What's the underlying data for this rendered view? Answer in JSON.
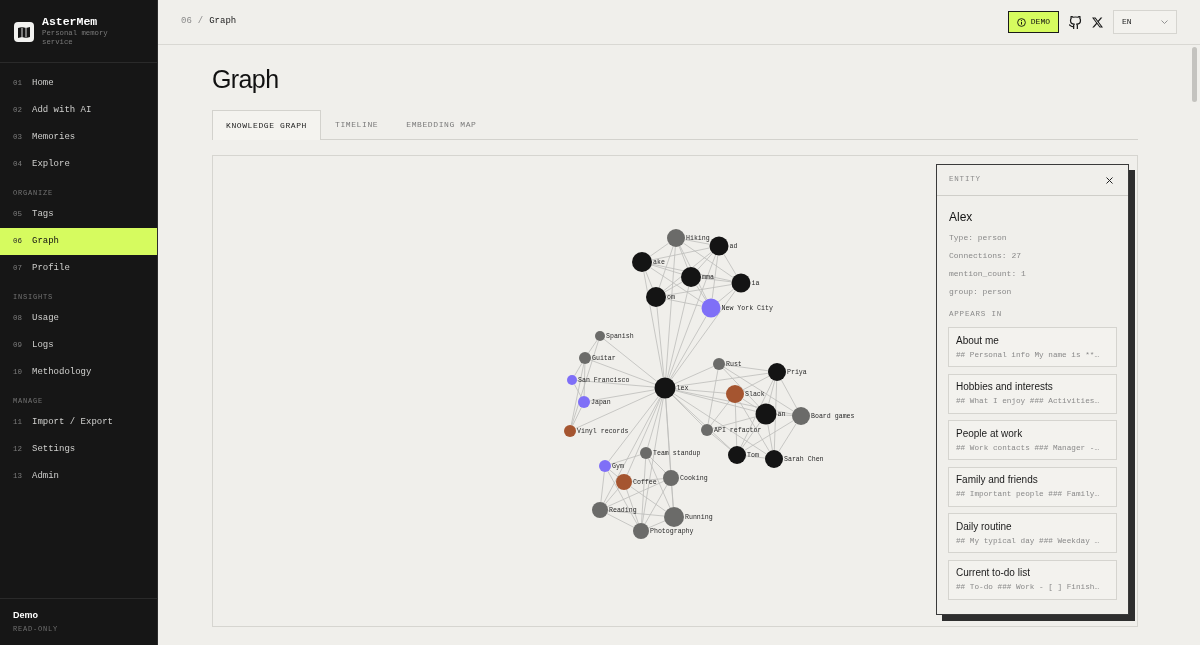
{
  "app": {
    "name": "AsterMem",
    "tagline": "Personal memory service"
  },
  "sidebar": {
    "groups": [
      {
        "items": [
          {
            "number": "01",
            "label": "Home",
            "selected": false
          },
          {
            "number": "02",
            "label": "Add with AI",
            "selected": false
          },
          {
            "number": "03",
            "label": "Memories",
            "selected": false
          },
          {
            "number": "04",
            "label": "Explore",
            "selected": false
          }
        ]
      },
      {
        "heading": "ORGANIZE",
        "items": [
          {
            "number": "05",
            "label": "Tags",
            "selected": false
          },
          {
            "number": "06",
            "label": "Graph",
            "selected": true
          },
          {
            "number": "07",
            "label": "Profile",
            "selected": false
          }
        ]
      },
      {
        "heading": "INSIGHTS",
        "items": [
          {
            "number": "08",
            "label": "Usage",
            "selected": false
          },
          {
            "number": "09",
            "label": "Logs",
            "selected": false
          },
          {
            "number": "10",
            "label": "Methodology",
            "selected": false
          }
        ]
      },
      {
        "heading": "MANAGE",
        "items": [
          {
            "number": "11",
            "label": "Import / Export",
            "selected": false
          },
          {
            "number": "12",
            "label": "Settings",
            "selected": false
          },
          {
            "number": "13",
            "label": "Admin",
            "selected": false
          }
        ]
      }
    ],
    "account": {
      "name": "Demo",
      "role": "READ-ONLY"
    }
  },
  "top_bar": {
    "breadcrumb": {
      "number": "06",
      "separator": "/",
      "current": "Graph"
    },
    "demo_badge": "DEMO",
    "language": "EN"
  },
  "page_title": "Graph",
  "tabs": [
    {
      "label": "KNOWLEDGE GRAPH",
      "selected": true
    },
    {
      "label": "TIMELINE",
      "selected": false
    },
    {
      "label": "EMBEDDING MAP",
      "selected": false
    }
  ],
  "graph": {
    "nodes": [
      {
        "label": "Hiking",
        "color": "#6b6b69"
      },
      {
        "label": "ad",
        "color": "#141414"
      },
      {
        "label": "ake",
        "color": "#141414"
      },
      {
        "label": "mma",
        "color": "#141414"
      },
      {
        "label": "ia",
        "color": "#141414"
      },
      {
        "label": "om",
        "color": "#141414"
      },
      {
        "label": "New York City",
        "color": "#7f6ff7"
      },
      {
        "label": "Spanish",
        "color": "#6b6b69"
      },
      {
        "label": "Guitar",
        "color": "#6b6b69"
      },
      {
        "label": "San Francisco",
        "color": "#7f6ff7"
      },
      {
        "label": "Japan",
        "color": "#7f6ff7"
      },
      {
        "label": "Vinyl records",
        "color": "#a55530"
      },
      {
        "label": "lex",
        "color": "#141414"
      },
      {
        "label": "Rust",
        "color": "#6b6b69"
      },
      {
        "label": "Priya",
        "color": "#141414"
      },
      {
        "label": "Slack",
        "color": "#a55530"
      },
      {
        "label": "an",
        "color": "#141414"
      },
      {
        "label": "Board games",
        "color": "#6b6b69"
      },
      {
        "label": "API refactor",
        "color": "#6b6b69"
      },
      {
        "label": "Tom",
        "color": "#141414"
      },
      {
        "label": "Sarah Chen",
        "color": "#141414"
      },
      {
        "label": "Team standup",
        "color": "#6b6b69"
      },
      {
        "label": "Gym",
        "color": "#7f6ff7"
      },
      {
        "label": "Coffee",
        "color": "#a55530"
      },
      {
        "label": "Cooking",
        "color": "#6b6b69"
      },
      {
        "label": "Reading",
        "color": "#6b6b69"
      },
      {
        "label": "Running",
        "color": "#6b6b69"
      },
      {
        "label": "Photography",
        "color": "#6b6b69"
      }
    ]
  },
  "entity_panel": {
    "title": "ENTITY",
    "name": "Alex",
    "properties": [
      "Type: person",
      "Connections: 27",
      "mention_count: 1",
      "group: person"
    ],
    "section_title": "APPEARS IN",
    "memories": [
      {
        "title": "About me",
        "snippet": "## Personal info My name is **…"
      },
      {
        "title": "Hobbies and interests",
        "snippet": "## What I enjoy ### Activities…"
      },
      {
        "title": "People at work",
        "snippet": "## Work contacts ### Manager -…"
      },
      {
        "title": "Family and friends",
        "snippet": "## Important people ### Family…"
      },
      {
        "title": "Daily routine",
        "snippet": "## My typical day ### Weekday …"
      },
      {
        "title": "Current to-do list",
        "snippet": "## To-do ### Work - [ ] Finish…"
      }
    ]
  }
}
